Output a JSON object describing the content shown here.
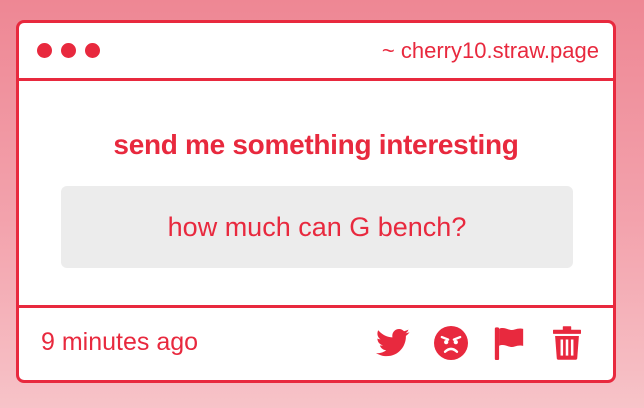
{
  "window": {
    "site_label": "~ cherry10.straw.page"
  },
  "main": {
    "prompt": "send me something interesting",
    "message": "how much can G bench?"
  },
  "footer": {
    "timestamp": "9 minutes ago",
    "actions": [
      {
        "icon": "twitter-icon"
      },
      {
        "icon": "angry-face-icon"
      },
      {
        "icon": "flag-icon"
      },
      {
        "icon": "trash-icon"
      }
    ]
  },
  "colors": {
    "accent": "#e8293e",
    "background_top": "#ee8794",
    "background_bottom": "#f7c3c8",
    "message_bg": "#ececec",
    "card_bg": "#ffffff"
  }
}
